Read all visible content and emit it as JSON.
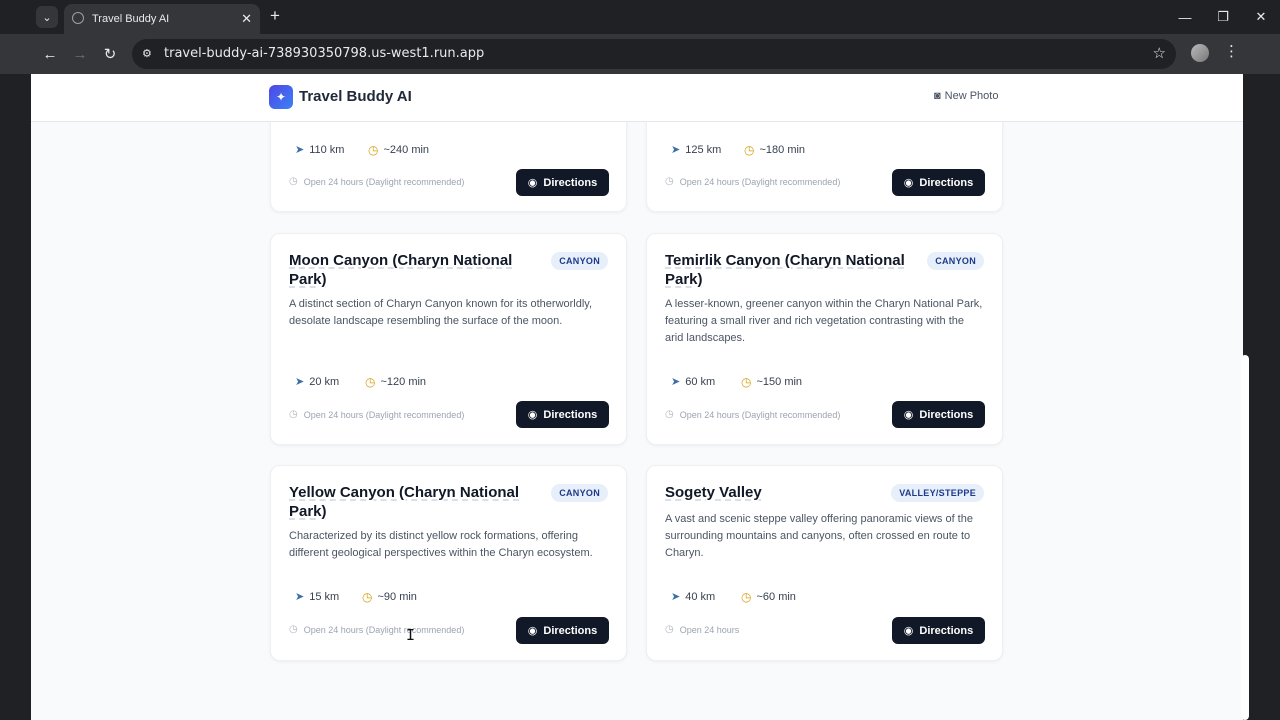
{
  "browser": {
    "tab_title": "Travel Buddy AI",
    "tab_close": "✕",
    "new_tab": "+",
    "url": "travel-buddy-ai-738930350798.us-west1.run.app",
    "win_min": "—",
    "win_restore": "❐",
    "win_close": "✕"
  },
  "app": {
    "brand": "Travel Buddy AI",
    "new_photo_label": "New Photo"
  },
  "directions_label": "Directions",
  "cards": [
    {
      "distance": "110 km",
      "duration": "~240 min",
      "hours": "Open 24 hours (Daylight recommended)"
    },
    {
      "distance": "125 km",
      "duration": "~180 min",
      "hours": "Open 24 hours (Daylight recommended)"
    },
    {
      "title": "Moon Canyon (Charyn National Park)",
      "badge": "CANYON",
      "description": "A distinct section of Charyn Canyon known for its otherworldly, desolate landscape resembling the surface of the moon.",
      "distance": "20 km",
      "duration": "~120 min",
      "hours": "Open 24 hours (Daylight recommended)"
    },
    {
      "title": "Temirlik Canyon (Charyn National Park)",
      "badge": "CANYON",
      "description": "A lesser-known, greener canyon within the Charyn National Park, featuring a small river and rich vegetation contrasting with the arid landscapes.",
      "distance": "60 km",
      "duration": "~150 min",
      "hours": "Open 24 hours (Daylight recommended)"
    },
    {
      "title": "Yellow Canyon (Charyn National Park)",
      "badge": "CANYON",
      "description": "Characterized by its distinct yellow rock formations, offering different geological perspectives within the Charyn ecosystem.",
      "distance": "15 km",
      "duration": "~90 min",
      "hours": "Open 24 hours (Daylight recommended)"
    },
    {
      "title": "Sogety Valley",
      "badge": "VALLEY/STEPPE",
      "description": "A vast and scenic steppe valley offering panoramic views of the surrounding mountains and canyons, often crossed en route to Charyn.",
      "distance": "40 km",
      "duration": "~60 min",
      "hours": "Open 24 hours"
    }
  ]
}
